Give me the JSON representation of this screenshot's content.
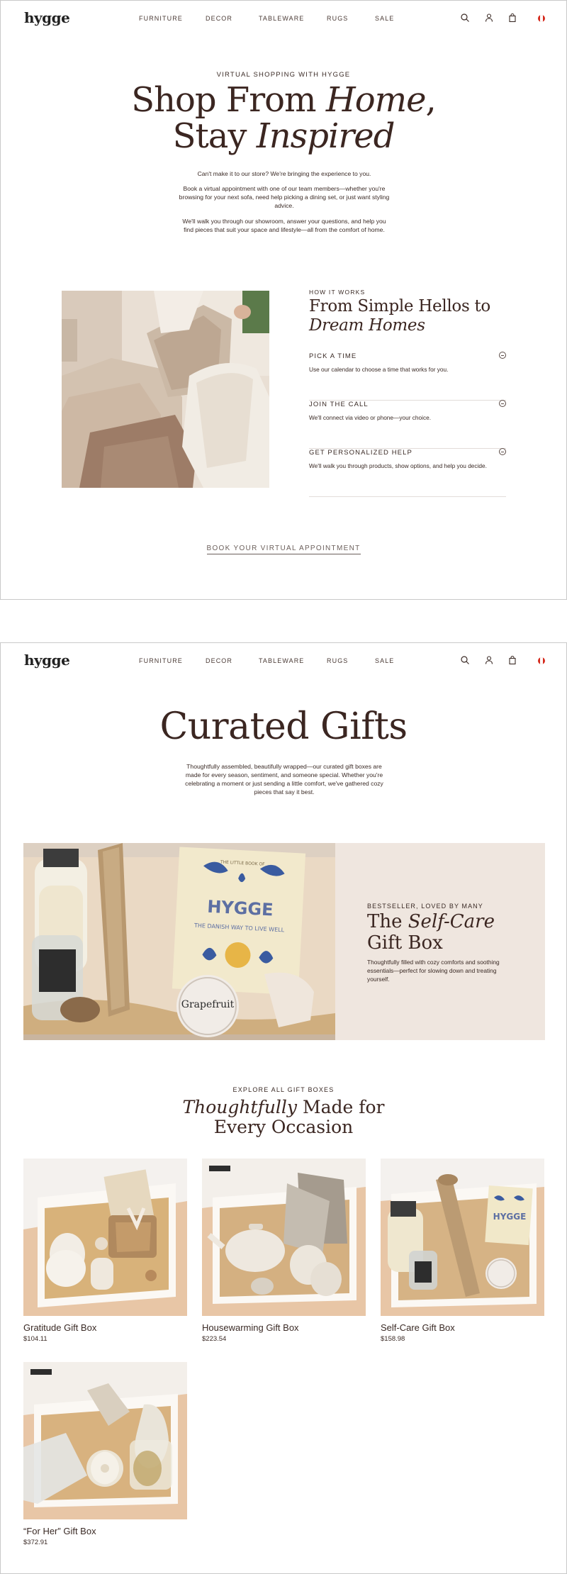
{
  "header": {
    "logo": "hygge",
    "nav": [
      "FURNITURE",
      "DECOR",
      "TABLEWARE",
      "RUGS",
      "SALE"
    ],
    "icons": [
      "search-icon",
      "account-icon",
      "bag-icon",
      "canada-flag-icon"
    ]
  },
  "virtual": {
    "eyebrow": "VIRTUAL SHOPPING WITH HYGGE",
    "title_1a": "Shop From ",
    "title_1b": "Home",
    "title_1c": ",",
    "title_2a": "Stay ",
    "title_2b": "Inspired",
    "p1": "Can't make it to our store? We're bringing the experience to you.",
    "p2": "Book a virtual appointment with one of our team members—whether you're browsing for your next sofa, need help picking a dining set, or just want styling advice.",
    "p3": "We'll walk you through our showroom, answer your questions, and help you find pieces that suit your space and lifestyle—all from the comfort of home."
  },
  "how_it_works": {
    "eyebrow": "HOW IT WORKS",
    "title_1": "From Simple Hellos to",
    "title_2": "Dream Homes",
    "steps": [
      {
        "title": "PICK A TIME",
        "desc": "Use our calendar to choose a time that works for you."
      },
      {
        "title": "JOIN THE CALL",
        "desc": "We'll connect via video or phone—your choice."
      },
      {
        "title": "GET PERSONALIZED HELP",
        "desc": "We'll walk you through products, show options, and help you decide."
      }
    ],
    "cta": "BOOK YOUR VIRTUAL APPOINTMENT"
  },
  "gifts": {
    "title": "Curated Gifts",
    "intro": "Thoughtfully assembled, beautifully wrapped—our curated gift boxes are made for every season, sentiment, and someone special. Whether you're celebrating a moment or just sending a little comfort, we've gathered cozy pieces that say it best.",
    "banner": {
      "eyebrow": "BESTSELLER, LOVED BY MANY",
      "title_a": "The ",
      "title_b": "Self-Care",
      "title_c": "Gift Box",
      "desc": "Thoughtfully filled with cozy comforts and soothing essentials—perfect for slowing down and treating yourself.",
      "book_label_1": "THE LITTLE BOOK OF",
      "book_label_2": "HYGGE",
      "book_label_3": "THE DANISH WAY TO LIVE WELL",
      "candle_label": "Grapefruit"
    },
    "section_eyebrow": "EXPLORE ALL GIFT BOXES",
    "section_title_a": "Thoughtfully",
    "section_title_b": " Made for",
    "section_title_c": "Every Occasion",
    "products": [
      {
        "name": "Gratitude Gift Box",
        "price": "$104.11"
      },
      {
        "name": "Housewarming Gift Box",
        "price": "$223.54"
      },
      {
        "name": "Self-Care Gift Box",
        "price": "$158.98"
      },
      {
        "name": "“For Her” Gift Box",
        "price": "$372.91"
      }
    ]
  },
  "colors": {
    "accent": "#3b2621",
    "banner_bg": "#efe6df",
    "box_bg": "#e8c6a6"
  }
}
